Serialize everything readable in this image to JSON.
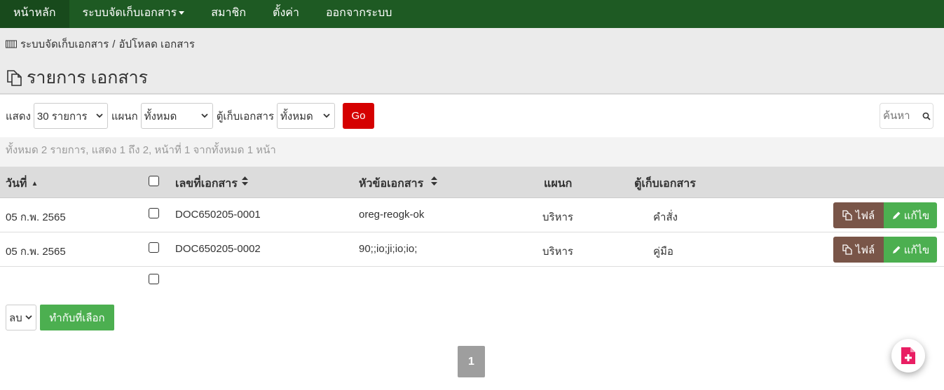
{
  "nav": {
    "home": "หน้าหลัก",
    "docs": "ระบบจัดเก็บเอกสาร",
    "members": "สมาชิก",
    "settings": "ตั้งค่า",
    "logout": "ออกจากระบบ"
  },
  "breadcrumb": {
    "root": "ระบบจัดเก็บเอกสาร",
    "separator": "/",
    "current": "อัปโหลด เอกสาร"
  },
  "page_title": "รายการ เอกสาร",
  "filter": {
    "show_label": "แสดง",
    "show_value": "30 รายการ",
    "dept_label": "แผนก",
    "dept_value": "ทั้งหมด",
    "cabinet_label": "ตู้เก็บเอกสาร",
    "cabinet_value": "ทั้งหมด",
    "go_label": "Go"
  },
  "search": {
    "placeholder": "ค้นหา"
  },
  "summary": "ทั้งหมด 2 รายการ, แสดง 1 ถึง 2, หน้าที่ 1 จากทั้งหมด 1 หน้า",
  "table": {
    "headers": {
      "date": "วันที่",
      "doc_no": "เลขที่เอกสาร",
      "subject": "หัวข้อเอกสาร",
      "dept": "แผนก",
      "cabinet": "ตู้เก็บเอกสาร"
    },
    "rows": [
      {
        "date": "05 ก.พ. 2565",
        "doc_no": "DOC650205-0001",
        "subject": "oreg-reogk-ok",
        "dept": "บริหาร",
        "cabinet": "คำสั่ง"
      },
      {
        "date": "05 ก.พ. 2565",
        "doc_no": "DOC650205-0002",
        "subject": "90;;io;ji;io;io;",
        "dept": "บริหาร",
        "cabinet": "คู่มือ"
      }
    ],
    "file_label": "ไฟล์",
    "edit_label": "แก้ไข"
  },
  "bulk": {
    "action_value": "ลบ",
    "apply_label": "ทำกับที่เลือก"
  },
  "pagination": {
    "current": "1"
  },
  "colors": {
    "navbar": "#1e5a23",
    "go": "#d50000",
    "file_btn": "#795548",
    "edit_btn": "#4caf50",
    "fab_icon": "#e91e63"
  }
}
